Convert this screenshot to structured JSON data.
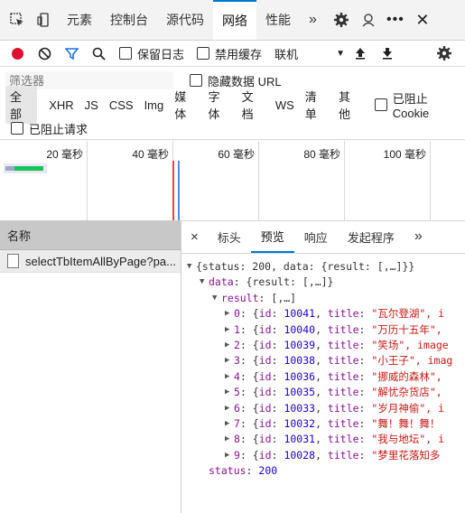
{
  "tabs": [
    "元素",
    "控制台",
    "源代码",
    "网络",
    "性能"
  ],
  "active_tab": "网络",
  "more_tabs": "»",
  "toolbar": {
    "preserve_log": "保留日志",
    "disable_cache": "禁用缓存",
    "throttle": "联机"
  },
  "filter": {
    "placeholder": "筛选器",
    "hide_data_urls": "隐藏数据 URL"
  },
  "types": [
    "全部",
    "XHR",
    "JS",
    "CSS",
    "Img",
    "媒体",
    "字体",
    "文档",
    "WS",
    "清单",
    "其他"
  ],
  "blocked_cookie": "已阻止 Cookie",
  "blocked_requests": "已阻止请求",
  "timeline": {
    "ticks": [
      "20 毫秒",
      "40 毫秒",
      "60 毫秒",
      "80 毫秒",
      "100 毫秒"
    ]
  },
  "requests_header": "名称",
  "requests": [
    "selectTbItemAllByPage?pa..."
  ],
  "subtabs": [
    "标头",
    "预览",
    "响应",
    "发起程序"
  ],
  "active_subtab": "预览",
  "preview": {
    "root": "{status: 200, data: {result: [,…]}}",
    "data_key": "data",
    "data_val": "{result: [,…]}",
    "result_key": "result",
    "result_val": "[,…]",
    "items": [
      {
        "idx": "0",
        "id": "10041",
        "title": "\"瓦尔登湖\", i"
      },
      {
        "idx": "1",
        "id": "10040",
        "title": "\"万历十五年\","
      },
      {
        "idx": "2",
        "id": "10039",
        "title": "\"笑场\", image"
      },
      {
        "idx": "3",
        "id": "10038",
        "title": "\"小王子\", imag"
      },
      {
        "idx": "4",
        "id": "10036",
        "title": "\"挪威的森林\","
      },
      {
        "idx": "5",
        "id": "10035",
        "title": "\"解忧杂货店\","
      },
      {
        "idx": "6",
        "id": "10033",
        "title": "\"岁月神偷\", i"
      },
      {
        "idx": "7",
        "id": "10032",
        "title": "\"舞！舞！舞！"
      },
      {
        "idx": "8",
        "id": "10031",
        "title": "\"我与地坛\", i"
      },
      {
        "idx": "9",
        "id": "10028",
        "title": "\"梦里花落知多"
      }
    ],
    "status_key": "status",
    "status_val": "200"
  }
}
